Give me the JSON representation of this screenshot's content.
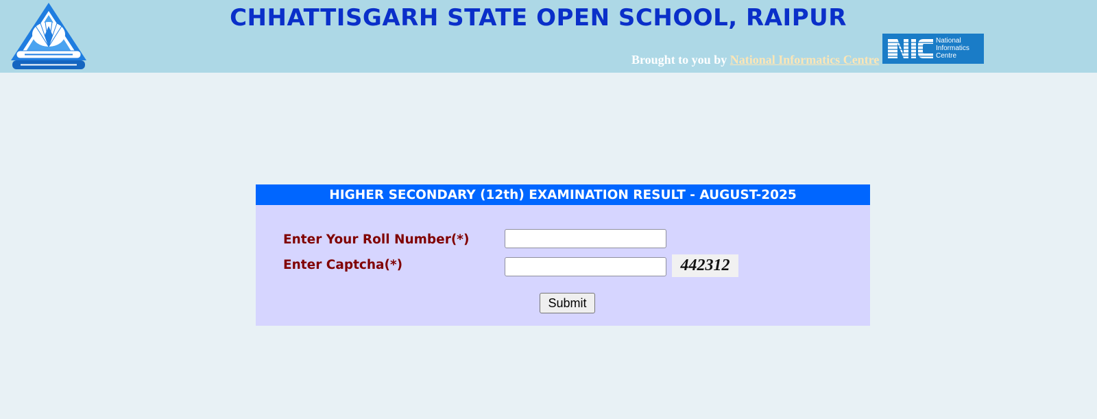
{
  "header": {
    "title": "CHHATTISGARH STATE OPEN SCHOOL, RAIPUR",
    "brought_prefix": "Brought to you by ",
    "nic_link": "National Informatics Centre",
    "logo_icon": "cgsos-emblem",
    "nic_logo_icon": "nic-logo",
    "nic_logo_lines": [
      "National",
      "Informatics",
      "Centre"
    ],
    "colors": {
      "banner": "#add8e6",
      "title": "#0a2fc9"
    }
  },
  "form": {
    "heading": "HIGHER SECONDARY (12th) EXAMINATION RESULT - AUGUST-2025",
    "roll_label": "Enter Your Roll Number(*)",
    "roll_value": "",
    "captcha_label": "Enter Captcha(*)",
    "captcha_value": "",
    "captcha_code": "442312",
    "submit_label": "Submit",
    "colors": {
      "heading_bg": "#0066ff",
      "panel_bg": "#d6d5ff",
      "label": "#800000"
    }
  }
}
